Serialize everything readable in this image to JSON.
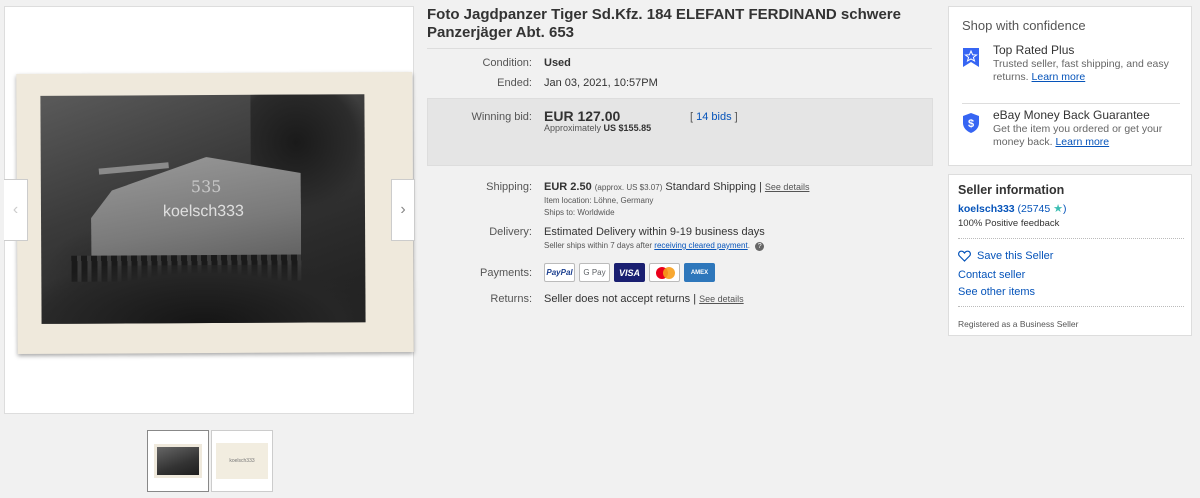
{
  "gallery": {
    "watermark": "koelsch333",
    "tank_number": "535",
    "thumb_back_text": "koelsch333",
    "prev_icon": "chevron-left-icon",
    "next_icon": "chevron-right-icon"
  },
  "listing": {
    "title": "Foto Jagdpanzer Tiger Sd.Kfz. 184 ELEFANT FERDINAND schwere Panzerjäger Abt. 653",
    "condition_label": "Condition:",
    "condition_value": "Used",
    "ended_label": "Ended:",
    "ended_value": "Jan 03, 2021, 10:57PM",
    "winning_bid_label": "Winning bid:",
    "winning_bid_value": "EUR 127.00",
    "approx_prefix": "Approximately",
    "approx_value": "US $155.85",
    "bids_open": "[",
    "bids_link": "14 bids",
    "bids_close": "]",
    "shipping_label": "Shipping:",
    "shipping_value": "EUR 2.50",
    "shipping_approx": "(approx. US $3.07)",
    "shipping_service": "Standard Shipping",
    "shipping_sep": "|",
    "shipping_details": "See details",
    "item_location": "Item location:  Löhne, Germany",
    "ships_to": "Ships to:  Worldwide",
    "delivery_label": "Delivery:",
    "delivery_value": "Estimated Delivery within 9-19 business days",
    "delivery_note_prefix": "Seller ships within 7 days after",
    "delivery_note_link": "receiving cleared payment",
    "delivery_note_suffix": ".",
    "payments_label": "Payments:",
    "payment_methods": [
      "PayPal",
      "G Pay",
      "VISA",
      "MasterCard",
      "AMEX"
    ],
    "returns_label": "Returns:",
    "returns_value": "Seller does not accept returns",
    "returns_sep": "|",
    "returns_details": "See details"
  },
  "confidence": {
    "title": "Shop with confidence",
    "top_rated_title": "Top Rated Plus",
    "top_rated_text": "Trusted seller, fast shipping, and easy returns.",
    "top_rated_link": "Learn more",
    "money_back_title": "eBay Money Back Guarantee",
    "money_back_text": "Get the item you ordered or get your money back.",
    "money_back_link": "Learn more"
  },
  "seller": {
    "title": "Seller information",
    "name": "koelsch333",
    "score": "(25745",
    "score_close": ")",
    "feedback": "100% Positive feedback",
    "save_seller": "Save this Seller",
    "contact_seller": "Contact seller",
    "see_other_items": "See other items",
    "registered": "Registered as a Business Seller"
  },
  "colors": {
    "link": "#0654ba",
    "star": "#3dbeb3",
    "bid_box": "#e5e5e5",
    "badge_blue": "#3665f3"
  }
}
